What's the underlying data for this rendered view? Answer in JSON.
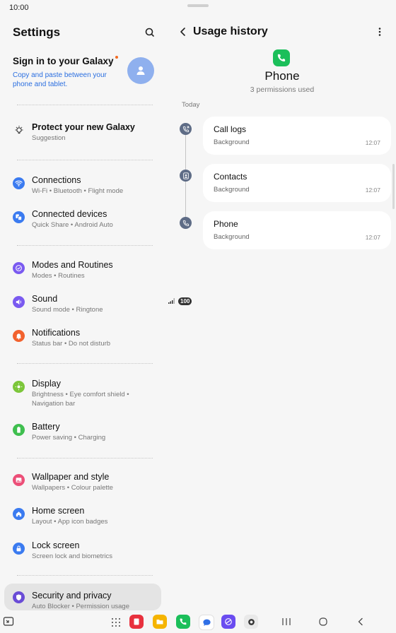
{
  "status": {
    "time": "10:00",
    "battery": "100"
  },
  "settings": {
    "title": "Settings",
    "account": {
      "title": "Sign in to your Galaxy",
      "subtitle": "Copy and paste between your phone and tablet."
    },
    "suggestion": {
      "title": "Protect your new Galaxy",
      "subtitle": "Suggestion"
    },
    "items": [
      {
        "title": "Connections",
        "subtitle": "Wi-Fi  •  Bluetooth  •  Flight mode",
        "icon": "wifi-icon",
        "color": "#3b7bf0"
      },
      {
        "title": "Connected devices",
        "subtitle": "Quick Share  •  Android Auto",
        "icon": "devices-icon",
        "color": "#3b7bf0"
      },
      {
        "title": "Modes and Routines",
        "subtitle": "Modes  •  Routines",
        "icon": "check-circle-icon",
        "color": "#7a5af0"
      },
      {
        "title": "Sound",
        "subtitle": "Sound mode  •  Ringtone",
        "icon": "speaker-icon",
        "color": "#7a5af0"
      },
      {
        "title": "Notifications",
        "subtitle": "Status bar  •  Do not disturb",
        "icon": "bell-icon",
        "color": "#f2622e"
      },
      {
        "title": "Display",
        "subtitle": "Brightness  •  Eye comfort shield  •  Navigation bar",
        "icon": "sun-icon",
        "color": "#7cc63a"
      },
      {
        "title": "Battery",
        "subtitle": "Power saving  •  Charging",
        "icon": "battery-icon",
        "color": "#3fbf4f"
      },
      {
        "title": "Wallpaper and style",
        "subtitle": "Wallpapers  •  Colour palette",
        "icon": "image-icon",
        "color": "#ec4f78"
      },
      {
        "title": "Home screen",
        "subtitle": "Layout  •  App icon badges",
        "icon": "home-icon",
        "color": "#3b7bf0"
      },
      {
        "title": "Lock screen",
        "subtitle": "Screen lock and biometrics",
        "icon": "lock-icon",
        "color": "#3b7bf0"
      },
      {
        "title": "Security and privacy",
        "subtitle": "Auto Blocker  •  Permission usage",
        "icon": "shield-icon",
        "color": "#6a4cd6"
      }
    ]
  },
  "usage": {
    "title": "Usage history",
    "app_name": "Phone",
    "permissions": "3 permissions used",
    "section": "Today",
    "entries": [
      {
        "title": "Call logs",
        "subtitle": "Background",
        "time": "12:07",
        "icon": "call-log-icon"
      },
      {
        "title": "Contacts",
        "subtitle": "Background",
        "time": "12:07",
        "icon": "contact-icon"
      },
      {
        "title": "Phone",
        "subtitle": "Background",
        "time": "12:07",
        "icon": "phone-icon"
      }
    ]
  },
  "colors": {
    "accent": "#2b6fe0",
    "phone_green": "#1bbf5a",
    "timeline_icon": "#5e6c86"
  }
}
